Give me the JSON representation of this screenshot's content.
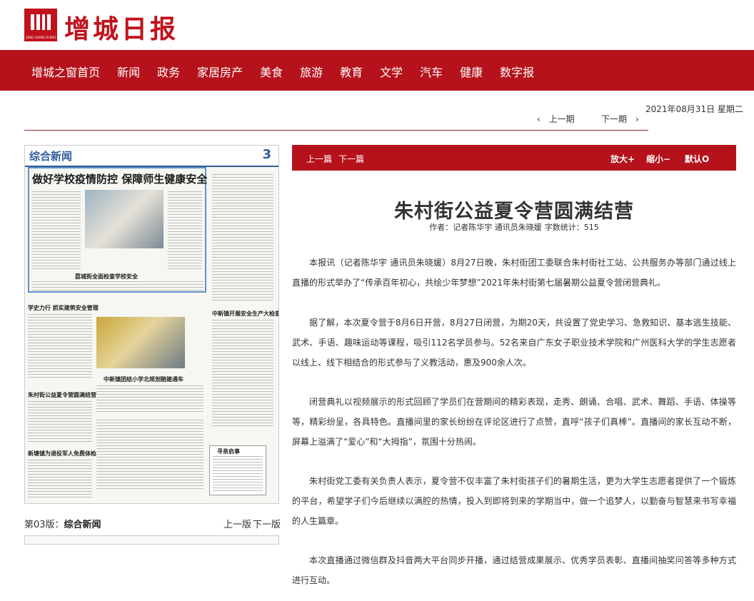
{
  "header": {
    "logo_text": "增城日报",
    "logo_small": "ZENG CHENG RI BAO"
  },
  "nav": {
    "items": [
      "增城之窗首页",
      "新闻",
      "政务",
      "家居房产",
      "美食",
      "旅游",
      "教育",
      "文学",
      "汽车",
      "健康",
      "数字报"
    ]
  },
  "date": "2021年08月31日 星期二",
  "period_nav": {
    "prev": "上一期",
    "next": "下一期"
  },
  "thumbnail": {
    "section_name": "综合新闻",
    "page_number": "3",
    "headline": "做好学校疫情防控 保障师生健康安全",
    "sub1": "荔城街全面检查学校安全",
    "sub2": "中新镇团结小学北规划赔建通车",
    "sub3": "学史力行 抓实建筑安全管理",
    "sub4": "朱村街公益夏令营圆满结营",
    "sub5": "新塘镇为退役军人免费体检",
    "sub6": "中新镇开展安全生产大检查行动",
    "notice": "寻亲启事"
  },
  "thumb_caption": {
    "prefix": "第03版：",
    "section": "综合新闻"
  },
  "version_nav": {
    "prev": "上一版",
    "next": "下一版"
  },
  "toolbar": {
    "prev_article": "上一篇",
    "next_article": "下一篇",
    "enlarge": "放大+",
    "shrink": "缩小−",
    "default": "默认O"
  },
  "article": {
    "title": "朱村街公益夏令营圆满结营",
    "byline": "作者：记者陈华宇 通讯员朱晓媛",
    "word_count": "字数统计：515",
    "paragraphs": [
      "本报讯（记者陈华宇 通讯员朱晓媛）8月27日晚，朱村街团工委联合朱村街社工站、公共服务办等部门通过线上直播的形式举办了“传承百年初心，共绘少年梦想”2021年朱村街第七届暑期公益夏令营闭营典礼。",
      "据了解，本次夏令营于8月6日开营，8月27日闭营，为期20天，共设置了党史学习、急救知识、基本逃生技能、武术、手语、趣味运动等课程，吸引112名学员参与。52名来自广东女子职业技术学院和广州医科大学的学生志愿者以线上、线下相结合的形式参与了义教活动，惠及900余人次。",
      "闭营典礼以视频展示的形式回顾了学员们在营期间的精彩表现，走秀、朗诵、合唱、武术、舞蹈、手语、体操等等，精彩纷呈，各具特色。直播间里的家长纷纷在评论区进行了点赞，直呼“孩子们真棒”。直播间的家长互动不断，屏幕上溢满了“爱心”和“大拇指”，氛围十分热闹。",
      "朱村街党工委有关负责人表示，夏令营不仅丰富了朱村街孩子们的暑期生活，更为大学生志愿者提供了一个锻炼的平台，希望学子们今后继续以满腔的热情，投入到即将到来的学期当中，做一个追梦人，以勤奋与智慧来书写幸福的人生篇章。",
      "本次直播通过微信群及抖音两大平台同步开播，通过结营成果展示、优秀学员表彰、直播间抽奖问答等多种方式进行互动。"
    ]
  }
}
